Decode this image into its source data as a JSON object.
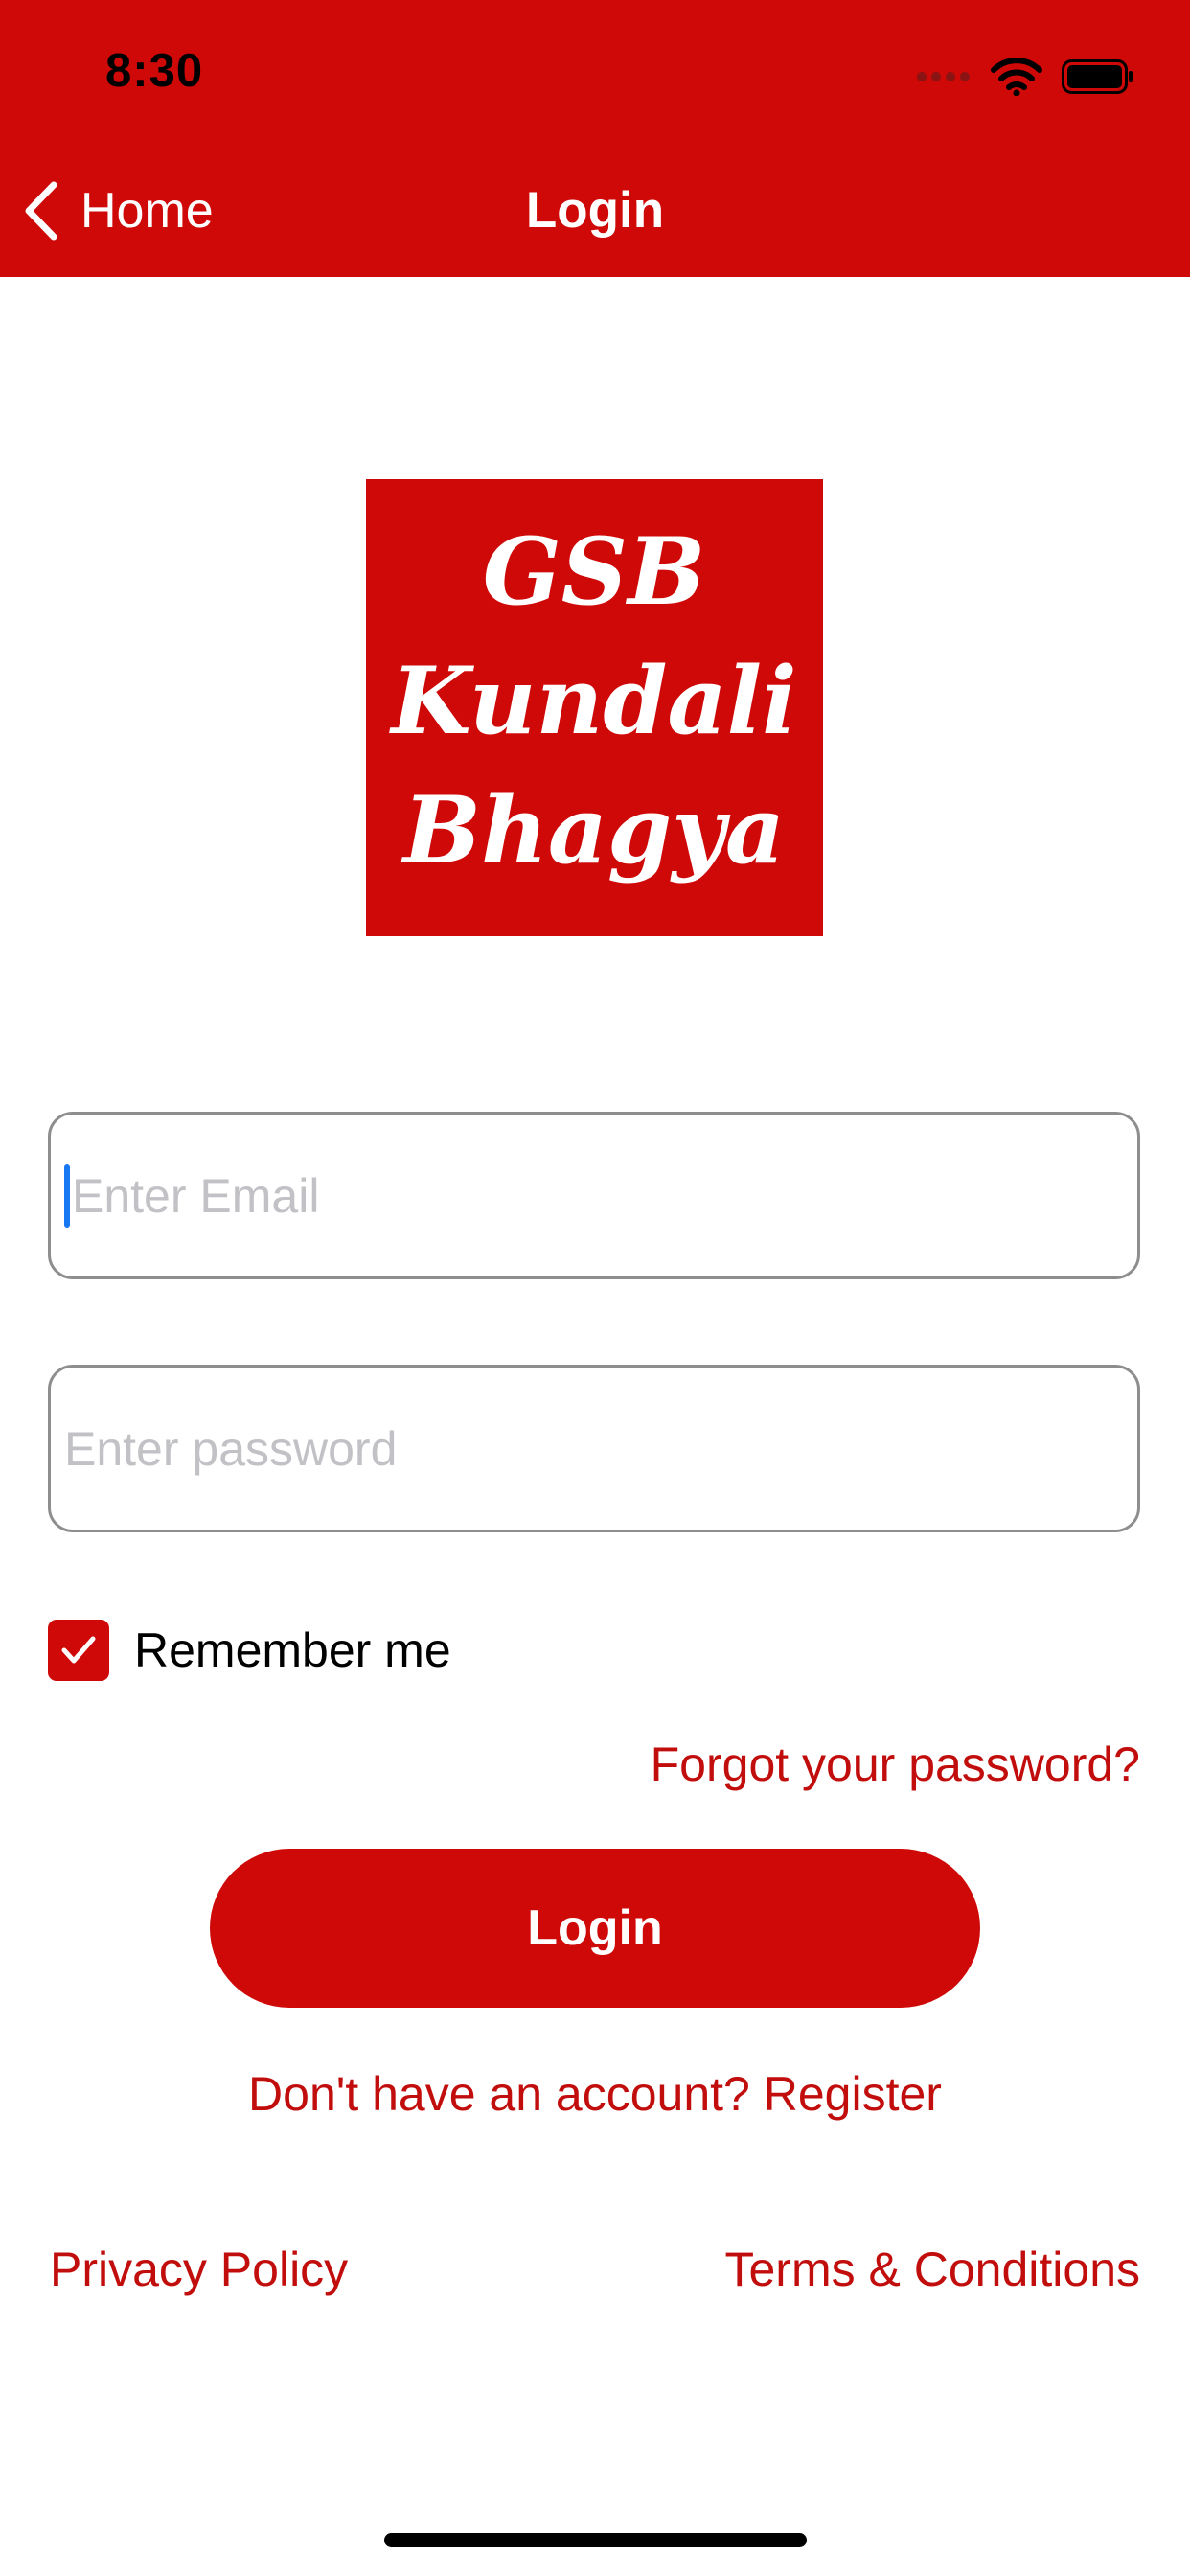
{
  "status_bar": {
    "time": "8:30"
  },
  "nav": {
    "back_label": "Home",
    "title": "Login"
  },
  "logo": {
    "text": "GSB Kundali Bhagya"
  },
  "form": {
    "email_placeholder": "Enter Email",
    "email_value": "",
    "password_placeholder": "Enter password",
    "password_value": "",
    "remember_label": "Remember me",
    "remember_checked": true,
    "forgot_label": "Forgot your password?",
    "login_label": "Login",
    "register_label": "Don't have an account? Register"
  },
  "footer": {
    "privacy_label": "Privacy Policy",
    "terms_label": "Terms & Conditions"
  },
  "colors": {
    "brand_red": "#cf0808",
    "link_red": "#c20d0d",
    "caret_blue": "#1877f2"
  },
  "icons": [
    "signal-icon",
    "wifi-icon",
    "battery-icon",
    "chevron-left-icon",
    "checkmark-icon"
  ]
}
